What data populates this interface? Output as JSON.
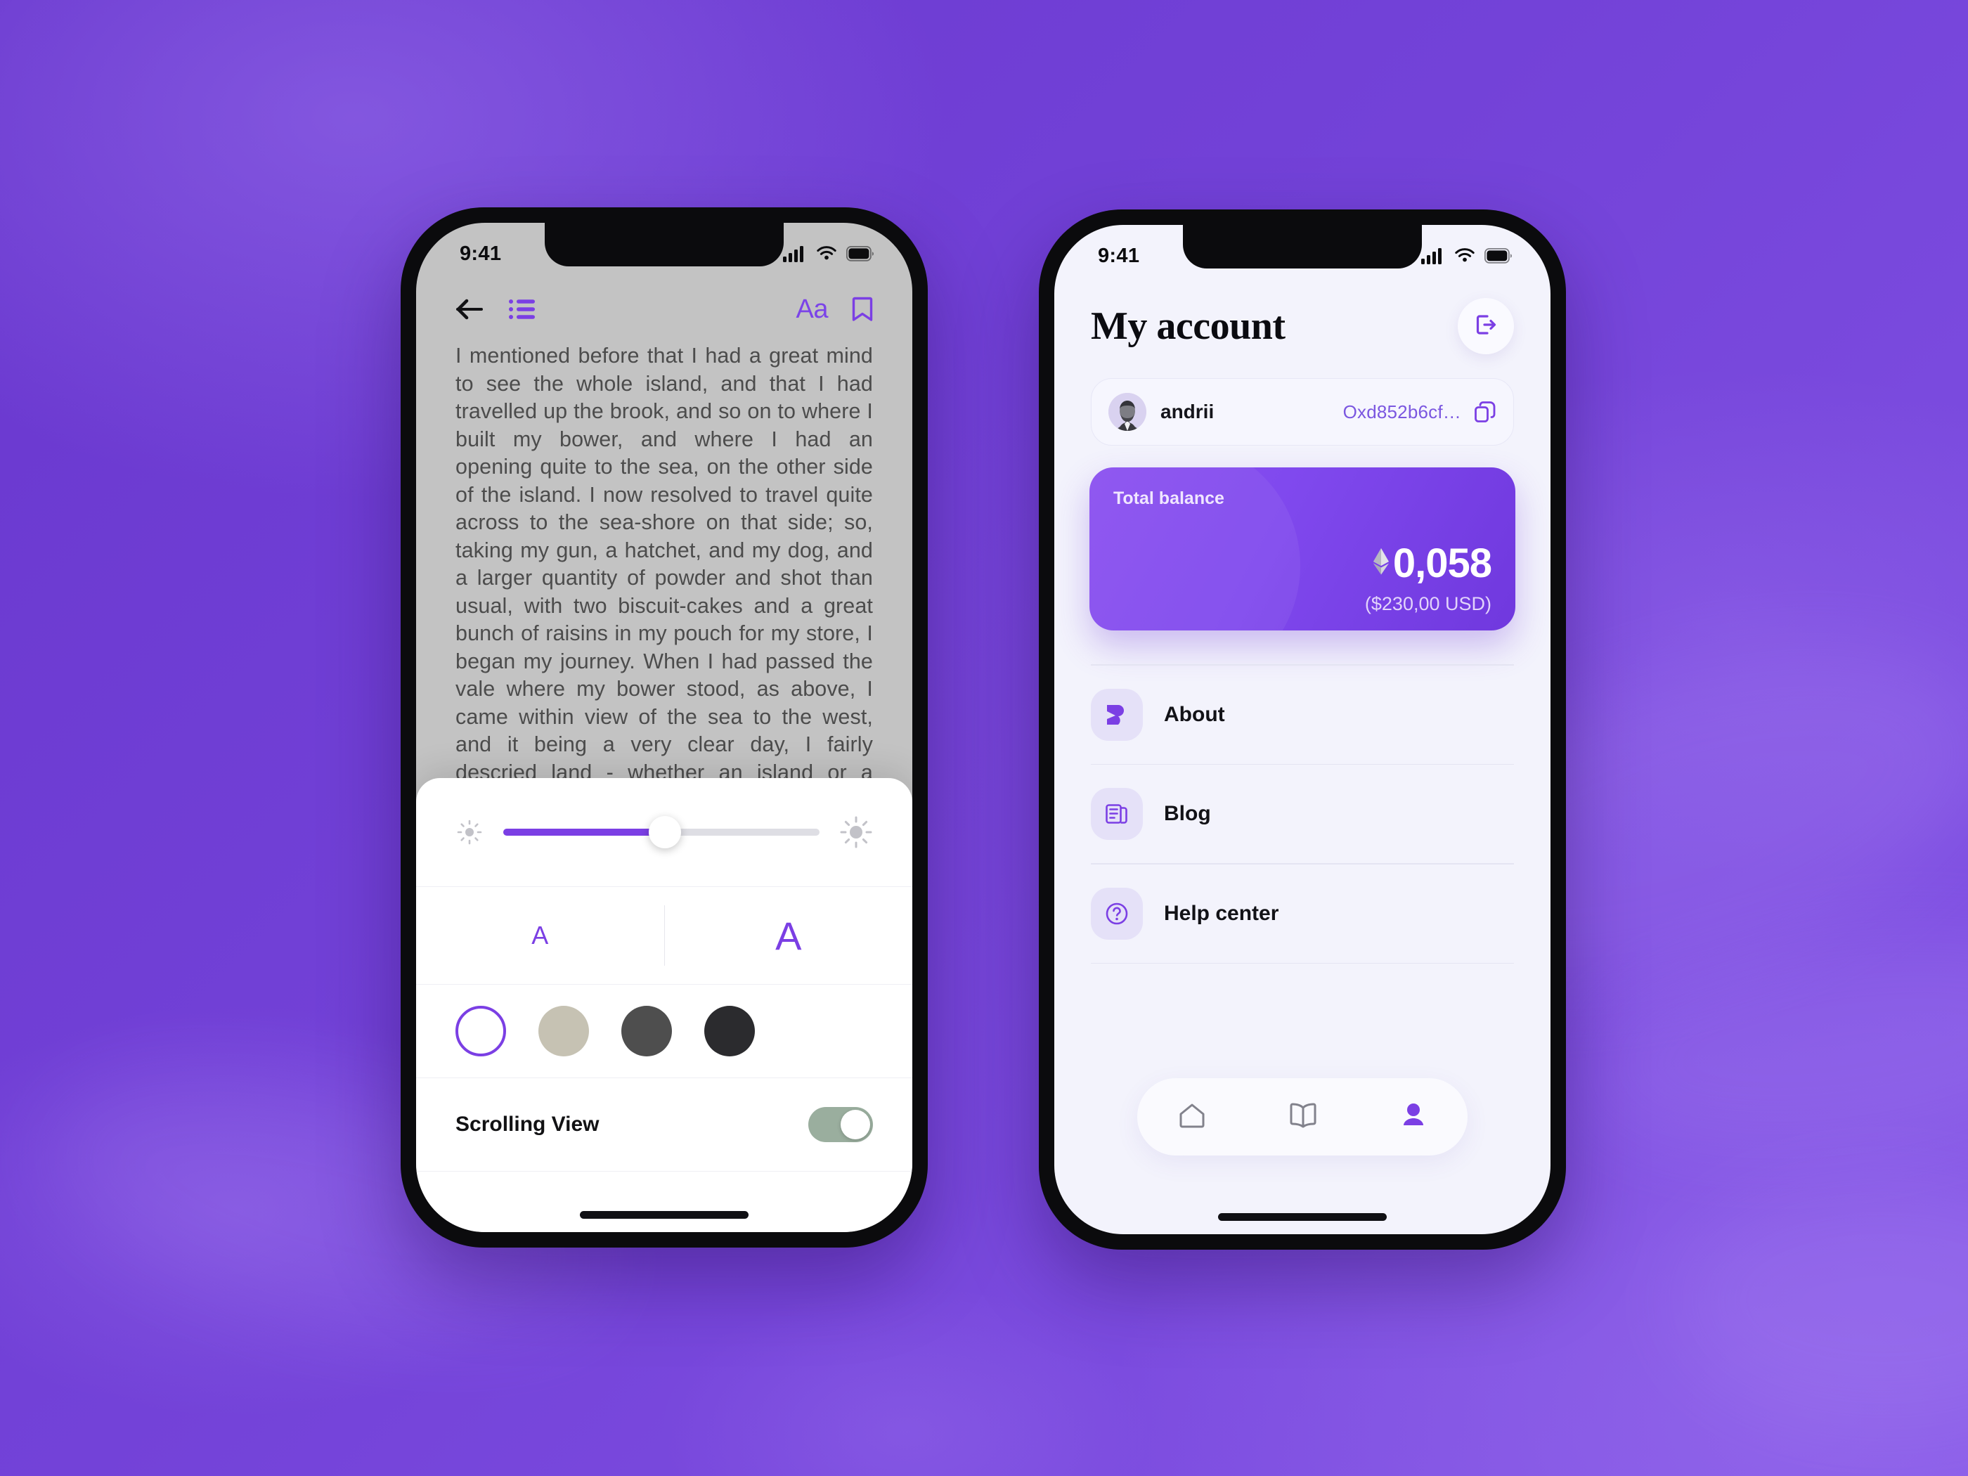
{
  "background": {
    "base_color": "#6B3FD1",
    "accent": "#7B3FE4"
  },
  "phone_left": {
    "status": {
      "time": "9:41",
      "cellular_icon": "cellular-signal-icon",
      "wifi_icon": "wifi-icon",
      "battery_icon": "battery-icon"
    },
    "toolbar": {
      "back_icon": "back-arrow-icon",
      "contents_icon": "table-of-contents-icon",
      "font_label": "Aa",
      "bookmark_icon": "bookmark-icon"
    },
    "reader": {
      "body_text": "I mentioned before that I had a great mind to see the whole island, and that I had travelled up the brook, and so on to where I built my bower, and where I had an opening quite to the sea, on the other side of the island. I now resolved to travel quite across to the sea-shore on that side; so, taking my gun, a hatchet, and my dog, and a larger quantity of powder and shot than usual, with two biscuit-cakes and a great bunch of raisins in my pouch for my store, I began my journey. When I had passed the vale where my bower stood, as above, I came within view of the sea to the west, and it being a very clear day, I fairly descried land - whether an island or a continent I could not tell; but it lay very high, extending"
    },
    "settings_sheet": {
      "brightness": {
        "low_icon": "brightness-low-icon",
        "high_icon": "brightness-high-icon",
        "value_percent": 51
      },
      "font_size": {
        "decrease_label": "A",
        "increase_label": "A"
      },
      "themes": [
        {
          "name": "white-theme-swatch",
          "color": "#FFFFFF",
          "selected": true
        },
        {
          "name": "sepia-theme-swatch",
          "color": "#C6C2B3",
          "selected": false
        },
        {
          "name": "gray-theme-swatch",
          "color": "#4E4E4E",
          "selected": false
        },
        {
          "name": "black-theme-swatch",
          "color": "#2B2B2E",
          "selected": false
        }
      ],
      "scrolling_view": {
        "label": "Scrolling View",
        "enabled": true,
        "track_color": "#9AAE9E"
      }
    }
  },
  "phone_right": {
    "status": {
      "time": "9:41",
      "cellular_icon": "cellular-signal-icon",
      "wifi_icon": "wifi-icon",
      "battery_icon": "battery-icon"
    },
    "header": {
      "title": "My account",
      "logout_icon": "logout-icon"
    },
    "user_card": {
      "avatar_icon": "user-avatar",
      "username": "andrii",
      "wallet_address": "Oxd852b6cf…",
      "copy_icon": "copy-icon"
    },
    "balance": {
      "label": "Total balance",
      "currency_icon": "ethereum-icon",
      "amount": "0,058",
      "fiat": "($230,00 USD)"
    },
    "menu": [
      {
        "label": "About",
        "icon": "about-logo-icon"
      },
      {
        "label": "Blog",
        "icon": "blog-document-icon"
      },
      {
        "label": "Help center",
        "icon": "help-question-icon"
      }
    ],
    "tabbar": [
      {
        "name": "tab-home",
        "icon": "home-icon",
        "active": false
      },
      {
        "name": "tab-library",
        "icon": "book-icon",
        "active": false
      },
      {
        "name": "tab-profile",
        "icon": "person-icon",
        "active": true
      }
    ]
  }
}
